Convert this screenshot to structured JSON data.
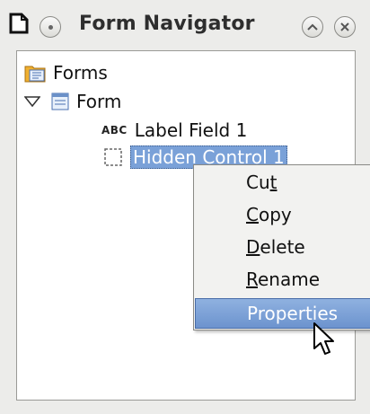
{
  "window": {
    "title": "Form Navigator",
    "icons": [
      "document-icon",
      "menu-circle-icon",
      "collapse-icon",
      "close-icon"
    ]
  },
  "tree": {
    "root": {
      "label": "Forms",
      "icon": "forms-folder-icon"
    },
    "form": {
      "label": "Form",
      "icon": "form-icon",
      "expanded": true
    },
    "children": [
      {
        "label": "Label Field 1",
        "icon": "abc-label-icon",
        "icon_text": "ABC"
      },
      {
        "label": "Hidden Control 1",
        "icon": "hidden-control-icon",
        "selected": true
      }
    ]
  },
  "context_menu": {
    "items": [
      {
        "label": "Cut",
        "mnemonic": "t"
      },
      {
        "label": "Copy",
        "mnemonic": "C"
      },
      {
        "label": "Delete",
        "mnemonic": "D"
      },
      {
        "label": "Rename",
        "mnemonic": "R"
      },
      {
        "label": "Properties",
        "highlighted": true
      }
    ]
  },
  "colors": {
    "selection": "#7aa1d8",
    "menu_highlight": "#6c93ce",
    "background": "#ececea"
  }
}
